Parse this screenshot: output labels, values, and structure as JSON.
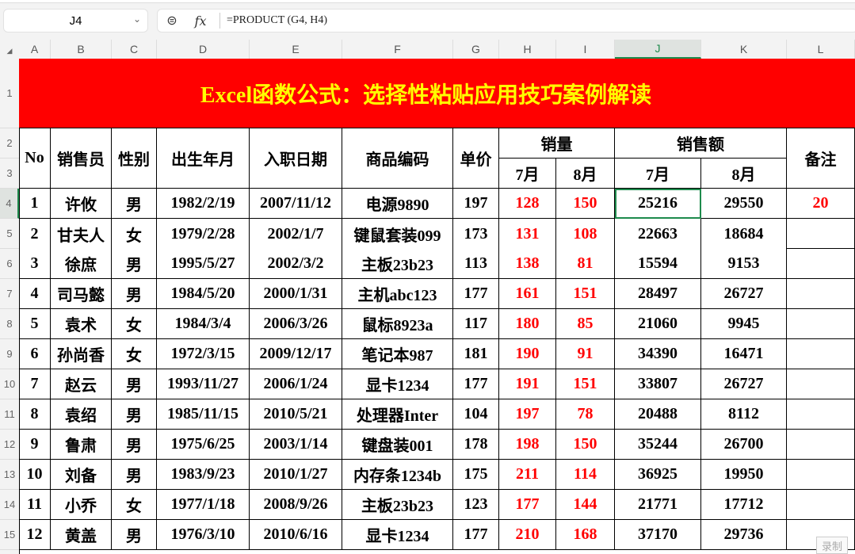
{
  "name_box": "J4",
  "formula": "=PRODUCT (G4, H4)",
  "columns": [
    "A",
    "B",
    "C",
    "D",
    "E",
    "F",
    "G",
    "H",
    "I",
    "J",
    "K",
    "L"
  ],
  "selected_column": "J",
  "rows": [
    "1",
    "2",
    "3",
    "4",
    "5",
    "6",
    "7",
    "8",
    "9",
    "10",
    "11",
    "12",
    "13",
    "14",
    "15"
  ],
  "selected_row": "4",
  "title": "Excel函数公式：选择性粘贴应用技巧案例解读",
  "headers": {
    "no": "No",
    "salesperson": "销售员",
    "gender": "性别",
    "birth": "出生年月",
    "hire": "入职日期",
    "code": "商品编码",
    "price": "单价",
    "qty": "销量",
    "amount": "销售额",
    "note": "备注",
    "jul": "7月",
    "aug": "8月"
  },
  "records": [
    [
      "1",
      "许攸",
      "男",
      "1982/2/19",
      "2007/11/12",
      "电源9890",
      "197",
      "128",
      "150",
      "25216",
      "29550",
      "20"
    ],
    [
      "2",
      "甘夫人",
      "女",
      "1979/2/28",
      "2002/1/7",
      "键鼠套装099",
      "173",
      "131",
      "108",
      "22663",
      "18684",
      ""
    ],
    [
      "3",
      "徐庶",
      "男",
      "1995/5/27",
      "2002/3/2",
      "主板23b23",
      "113",
      "138",
      "81",
      "15594",
      "9153",
      ""
    ],
    [
      "4",
      "司马懿",
      "男",
      "1984/5/20",
      "2000/1/31",
      "主机abc123",
      "177",
      "161",
      "151",
      "28497",
      "26727",
      ""
    ],
    [
      "5",
      "袁术",
      "女",
      "1984/3/4",
      "2006/3/26",
      "鼠标8923a",
      "117",
      "180",
      "85",
      "21060",
      "9945",
      ""
    ],
    [
      "6",
      "孙尚香",
      "女",
      "1972/3/15",
      "2009/12/17",
      "笔记本987",
      "181",
      "190",
      "91",
      "34390",
      "16471",
      ""
    ],
    [
      "7",
      "赵云",
      "男",
      "1993/11/27",
      "2006/1/24",
      "显卡1234",
      "177",
      "191",
      "151",
      "33807",
      "26727",
      ""
    ],
    [
      "8",
      "袁绍",
      "男",
      "1985/11/15",
      "2010/5/21",
      "处理器Inter",
      "104",
      "197",
      "78",
      "20488",
      "8112",
      ""
    ],
    [
      "9",
      "鲁肃",
      "男",
      "1975/6/25",
      "2003/1/14",
      "键盘装001",
      "178",
      "198",
      "150",
      "35244",
      "26700",
      ""
    ],
    [
      "10",
      "刘备",
      "男",
      "1983/9/23",
      "2010/1/27",
      "内存条1234b",
      "175",
      "211",
      "114",
      "36925",
      "19950",
      ""
    ],
    [
      "11",
      "小乔",
      "女",
      "1977/1/18",
      "2008/9/26",
      "主板23b23",
      "123",
      "177",
      "144",
      "21771",
      "17712",
      ""
    ],
    [
      "12",
      "黄盖",
      "男",
      "1976/3/10",
      "2010/6/16",
      "显卡1234",
      "177",
      "210",
      "168",
      "37170",
      "29736",
      ""
    ]
  ],
  "record_button": "录制",
  "colors": {
    "title_bg": "#ff0000",
    "title_text": "#ffff00",
    "highlight": "#ff0000",
    "selection": "#1e8a4c"
  }
}
